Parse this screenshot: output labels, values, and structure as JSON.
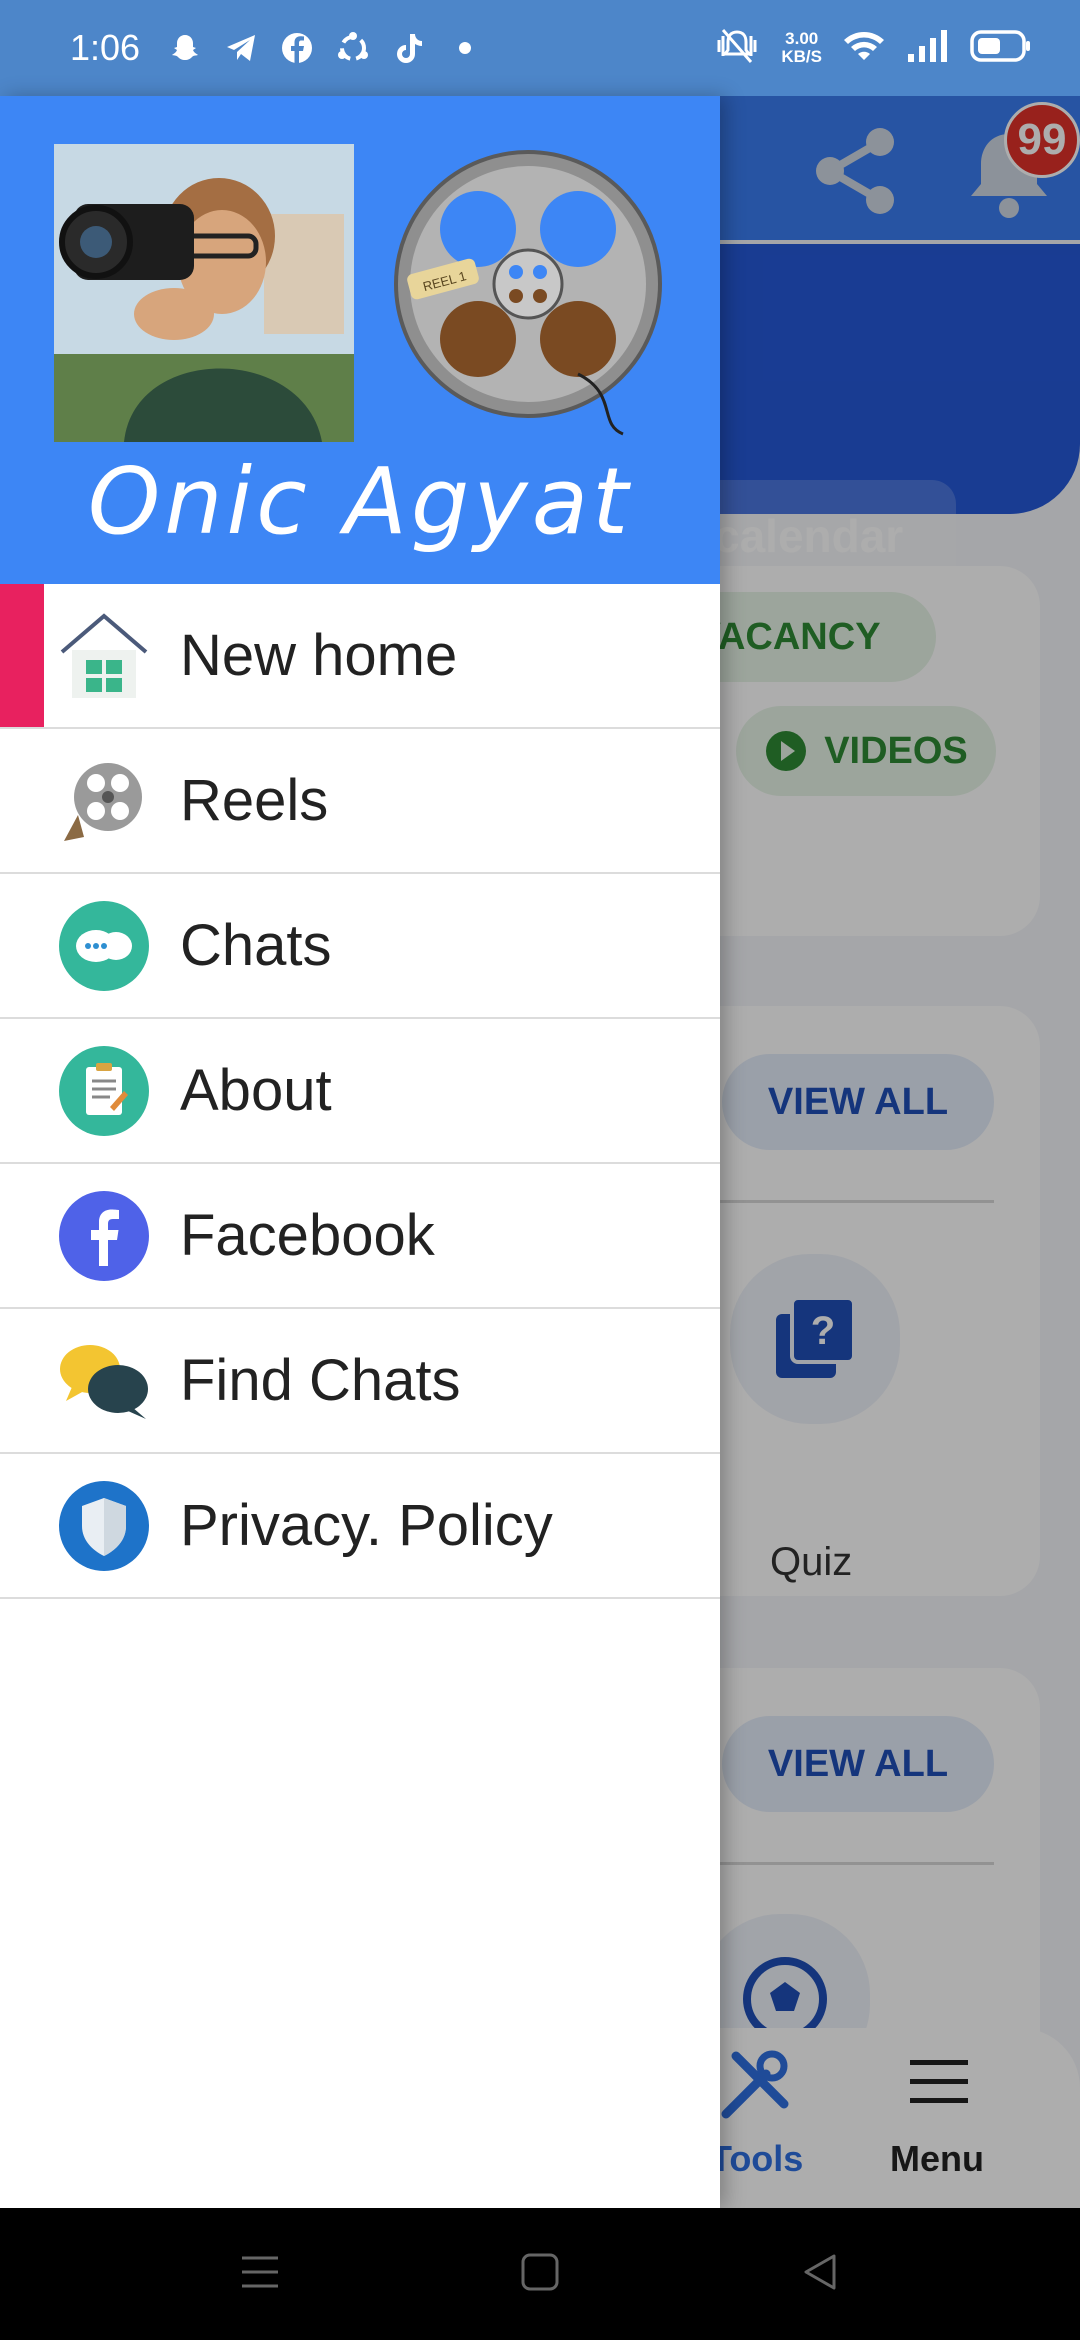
{
  "status_bar": {
    "time": "1:06",
    "net_speed_value": "3.00",
    "net_speed_unit": "KB/S",
    "app_icons": [
      "snapchat-icon",
      "telegram-icon",
      "facebook-icon",
      "sync-icon",
      "tiktok-icon",
      "dot-icon"
    ],
    "battery_level": 0.55
  },
  "drawer": {
    "title": "Onic Agyat",
    "reel_tag": "REEL 1",
    "items": [
      {
        "label": "New home",
        "icon": "home-icon",
        "active": true
      },
      {
        "label": "Reels",
        "icon": "film-reel-icon",
        "active": false
      },
      {
        "label": "Chats",
        "icon": "chat-bubbles-icon",
        "active": false
      },
      {
        "label": "About",
        "icon": "clipboard-icon",
        "active": false
      },
      {
        "label": "Facebook",
        "icon": "facebook-icon",
        "active": false
      },
      {
        "label": "Find Chats",
        "icon": "speech-bubbles-icon",
        "active": false
      },
      {
        "label": "Privacy. Policy",
        "icon": "shield-icon",
        "active": false
      }
    ],
    "active_color": "#e8215f"
  },
  "background": {
    "notification_count": "99",
    "calendar_label": "calendar",
    "vacancy_label": "VACANCY",
    "videos_label": "VIDEOS",
    "view_all_1": "VIEW ALL",
    "view_all_2": "VIEW ALL",
    "quiz_label": "Quiz",
    "tools_label": "Tools",
    "menu_label": "Menu"
  },
  "colors": {
    "header_blue": "#3d86f5",
    "status_blue": "#4d86c9",
    "hero_blue": "#2559d8"
  }
}
